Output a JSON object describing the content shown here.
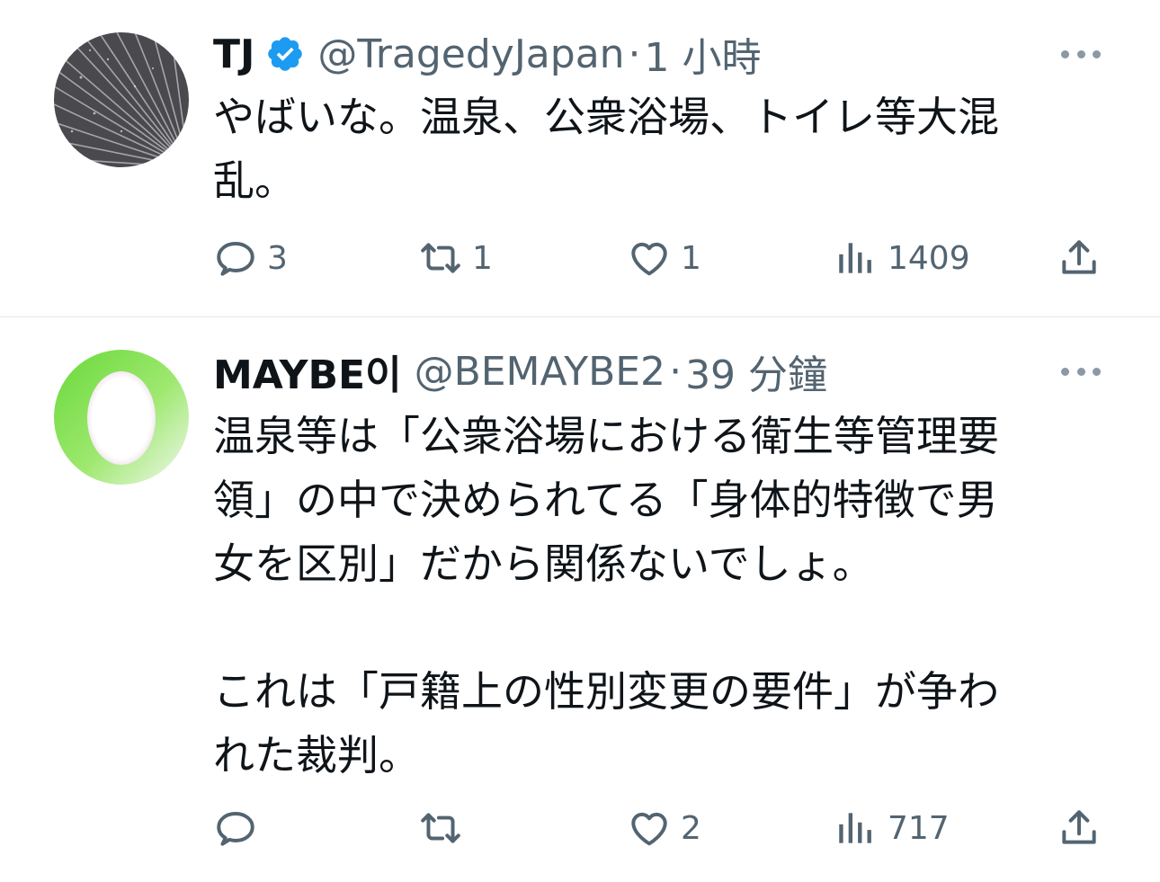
{
  "tweets": [
    {
      "name": "TJ",
      "verified": true,
      "handle": "@TragedyJapan",
      "separator": "·",
      "time": "1 小時",
      "text": "やばいな。温泉、公衆浴場、トイレ等大混\n乱。",
      "counts": {
        "replies": "3",
        "retweets": "1",
        "likes": "1",
        "views": "1409"
      }
    },
    {
      "name": "MAYBE이",
      "verified": false,
      "handle": "@BEMAYBE2",
      "separator": "·",
      "time": "39 分鐘",
      "text": "温泉等は「公衆浴場における衛生等管理要\n領」の中で決められてる「身体的特徴で男\n女を区別」だから関係ないでしょ。\n\nこれは「戸籍上の性別変更の要件」が争わ\nれた裁判。",
      "counts": {
        "replies": "",
        "retweets": "",
        "likes": "2",
        "views": "717"
      }
    }
  ],
  "icons": {
    "more": "more-dots-icon",
    "reply": "reply-bubble-icon",
    "retweet": "retweet-icon",
    "like": "heart-icon",
    "views": "views-bar-chart-icon",
    "share": "share-upload-icon",
    "verified": "verified-badge-icon"
  },
  "colors": {
    "text": "#0f1419",
    "secondary": "#536471",
    "verified": "#1d9bf0",
    "divider": "#e1e6ea"
  }
}
